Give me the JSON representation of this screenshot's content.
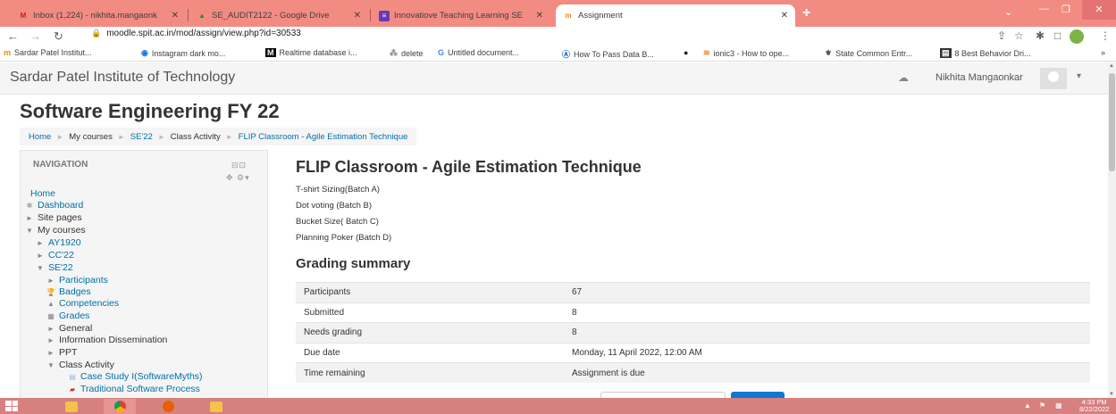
{
  "browser": {
    "tabs": [
      {
        "title": "Inbox (1,224) - nikhita.mangaonk",
        "icon": "gmail-icon"
      },
      {
        "title": "SE_AUDIT2122 - Google Drive",
        "icon": "google-drive-icon"
      },
      {
        "title": "Innovatiove Teaching Learning SE",
        "icon": "google-forms-icon"
      },
      {
        "title": "Assignment",
        "icon": "moodle-icon"
      }
    ],
    "new_tab": "+",
    "url": "moodle.spit.ac.in/mod/assign/view.php?id=30533",
    "bookmarks": [
      "Sardar Patel Institut...",
      "Instagram dark mo...",
      "Realtime database i...",
      "delete",
      "Untitled document...",
      "How To Pass Data B...",
      "",
      "ionic3 - How to ope...",
      "State Common Entr...",
      "8 Best Behavior Dri..."
    ],
    "bookmarks_more": "»"
  },
  "site": {
    "name": "Sardar Patel Institute of Technology",
    "user": "Nikhita Mangaonkar"
  },
  "course_title": "Software Engineering FY 22",
  "breadcrumb": [
    "Home",
    "My courses",
    "SE'22",
    "Class Activity",
    "FLIP Classroom - Agile Estimation Technique"
  ],
  "navigation": {
    "header": "NAVIGATION",
    "items": [
      {
        "label": "Home",
        "link": true
      },
      {
        "label": "Dashboard",
        "link": true,
        "icon": "dashboard-icon"
      },
      {
        "label": "Site pages",
        "link": false,
        "icon": "expand-arrow-icon"
      },
      {
        "label": "My courses",
        "link": false,
        "icon": "collapse-arrow-icon"
      },
      {
        "label": "AY1920",
        "link": true,
        "icon": "expand-arrow-icon"
      },
      {
        "label": "CC'22",
        "link": true,
        "icon": "expand-arrow-icon"
      },
      {
        "label": "SE'22",
        "link": true,
        "icon": "collapse-arrow-icon"
      },
      {
        "label": "Participants",
        "link": true,
        "icon": "expand-arrow-icon"
      },
      {
        "label": "Badges",
        "link": true,
        "icon": "badge-icon"
      },
      {
        "label": "Competencies",
        "link": true,
        "icon": "competencies-icon"
      },
      {
        "label": "Grades",
        "link": true,
        "icon": "grades-icon"
      },
      {
        "label": "General",
        "link": false,
        "icon": "expand-arrow-icon"
      },
      {
        "label": "Information Dissemination",
        "link": false,
        "icon": "expand-arrow-icon"
      },
      {
        "label": "PPT",
        "link": false,
        "icon": "expand-arrow-icon"
      },
      {
        "label": "Class Activity",
        "link": false,
        "icon": "collapse-arrow-icon"
      },
      {
        "label": "Case Study I(SoftwareMyths)",
        "link": true,
        "icon": "assignment-icon"
      },
      {
        "label": "Traditional Software Process",
        "link": true,
        "icon": "pdf-icon"
      }
    ]
  },
  "activity": {
    "title": "FLIP Classroom - Agile Estimation Technique",
    "intro": [
      "T-shirt Sizing(Batch A)",
      "Dot voting (Batch B)",
      "Bucket Size( Batch C)",
      "Planning Poker (Batch D)"
    ]
  },
  "grading": {
    "title": "Grading summary",
    "rows": [
      [
        "Participants",
        "67"
      ],
      [
        "Submitted",
        "8"
      ],
      [
        "Needs grading",
        "8"
      ],
      [
        "Due date",
        "Monday, 11 April 2022, 12:00 AM"
      ],
      [
        "Time remaining",
        "Assignment is due"
      ]
    ]
  },
  "taskbar": {
    "time": "4:33 PM",
    "date": "8/22/2022"
  },
  "colors": {
    "tabbar": "#f28b82",
    "link": "#0070a8",
    "taskbar": "#d78080",
    "button": "#1177d1"
  }
}
